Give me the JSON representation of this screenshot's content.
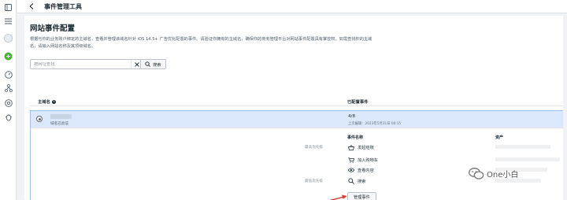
{
  "header": {
    "title": "事件管理工具"
  },
  "page": {
    "title": "网站事件配置",
    "description": "根据与你的业务账户绑定的主域名，查看并管理该域名针对 iOS 14.5+ 广告优化配置的事件。请验证你拥有的主域名，确保你的商务管理平台对网站事件配置具有掌控权。如需查找你的主域名，请输入网站名称及其顶级域名。"
  },
  "search": {
    "placeholder": "按网址查找",
    "button_label": "搜索"
  },
  "table": {
    "col_domain": "主域名",
    "col_events": "已配置事件"
  },
  "domain_row": {
    "status": "域名已验证",
    "event_count": "4/8",
    "updated": "上次编辑：2023年5月31日 00:15"
  },
  "events_panel": {
    "col_event": "事件名称",
    "col_asset": "资产",
    "priority_highest": "最高优先级",
    "priority_lowest": "最低优先级",
    "events": [
      {
        "label": "发起结账",
        "icon": "basket-icon"
      },
      {
        "label": "加入购物车",
        "icon": "cart-icon"
      },
      {
        "label": "查看内容",
        "icon": "eye-icon"
      },
      {
        "label": "搜索",
        "icon": "search-icon"
      }
    ],
    "manage_button": "管理事件"
  },
  "watermark": {
    "text": "One小白"
  },
  "colors": {
    "selected_row": "#dbe8fb",
    "selected_border": "#9fc0f1",
    "add_button": "#42b72a",
    "arrow": "#e0352b"
  }
}
